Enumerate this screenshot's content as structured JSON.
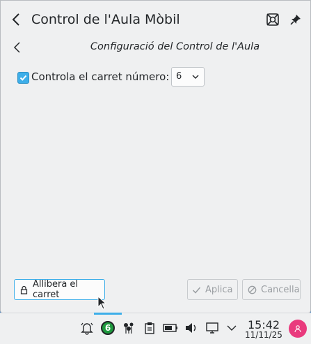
{
  "window": {
    "title": "Control de l'Aula Mòbil",
    "page_title": "Configuració del Control de l'Aula"
  },
  "form": {
    "checkbox_label": "Controla el carret número:",
    "checkbox_checked": true,
    "cart_number": "6"
  },
  "footer": {
    "release_label": "Allibera el carret",
    "apply_label": "Aplica",
    "cancel_label": "Cancella"
  },
  "taskbar": {
    "badge_number": "6",
    "time": "15:42",
    "date": "11/11/25",
    "accent_color": "#3daee9",
    "avatar_color": "#e93a7d"
  },
  "icons": [
    "back-icon",
    "lifebuoy-icon",
    "pin-icon",
    "check-icon",
    "chevron-down-icon",
    "lock-icon",
    "cancel-icon",
    "bell-icon",
    "network-icon",
    "clipboard-icon",
    "battery-icon",
    "volume-icon",
    "display-icon",
    "user-icon"
  ]
}
